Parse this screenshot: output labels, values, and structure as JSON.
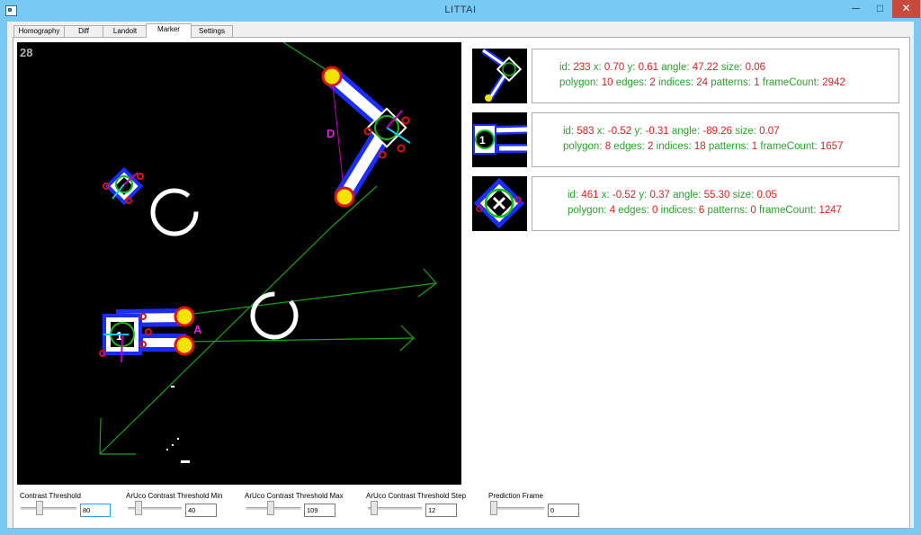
{
  "window": {
    "title": "LITTAI",
    "minimize_glyph": "─",
    "maximize_glyph": "□",
    "close_glyph": "✕"
  },
  "tabs": [
    {
      "label": "Homography"
    },
    {
      "label": "Diff"
    },
    {
      "label": "Landolt"
    },
    {
      "label": "Marker",
      "active": true
    },
    {
      "label": "Settings"
    }
  ],
  "camera": {
    "frame_number": "28",
    "label_d": "D",
    "label_a": "A"
  },
  "markers": [
    {
      "id": "233",
      "x": "0.70",
      "y": "0.61",
      "angle": "47.22",
      "size": "0.06",
      "polygon": "10",
      "edges": "2",
      "indices": "24",
      "patterns": "1",
      "frameCount": "2942"
    },
    {
      "id": "583",
      "x": "-0.52",
      "y": "-0.31",
      "angle": "-89.26",
      "size": "0.07",
      "polygon": "8",
      "edges": "2",
      "indices": "18",
      "patterns": "1",
      "frameCount": "1657"
    },
    {
      "id": "461",
      "x": "-0.52",
      "y": "0.37",
      "angle": "55.30",
      "size": "0.05",
      "polygon": "4",
      "edges": "0",
      "indices": "6",
      "patterns": "0",
      "frameCount": "1247"
    }
  ],
  "field_labels": {
    "id": "id:",
    "x": "x:",
    "y": "y:",
    "angle": "angle:",
    "size": "size:",
    "polygon": "polygon:",
    "edges": "edges:",
    "indices": "indices:",
    "patterns": "patterns:",
    "frameCount": "frameCount:"
  },
  "controls": [
    {
      "label": "Contrast Threshold",
      "value": "80",
      "focused": true,
      "level": 0.31
    },
    {
      "label": "ArUco Contrast Threshold Min",
      "value": "40",
      "level": 0.16
    },
    {
      "label": "ArUco Contrast Threshold Max",
      "value": "109",
      "level": 0.43
    },
    {
      "label": "ArUco Contrast Threshold Step",
      "value": "12",
      "level": 0.05
    },
    {
      "label": "Prediction Frame",
      "value": "0",
      "level": 0.0
    }
  ]
}
